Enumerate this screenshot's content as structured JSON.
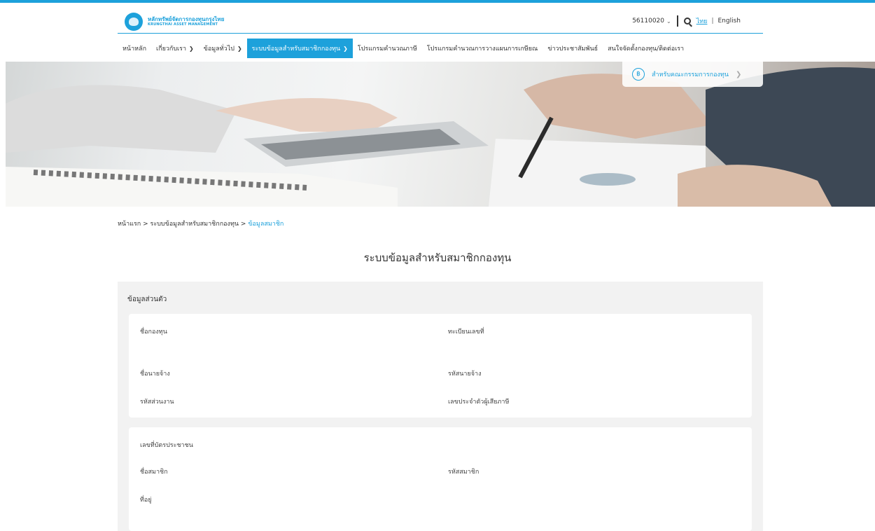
{
  "header": {
    "logo_th": "หลักทรัพย์จัดการกองทุนกรุงไทย",
    "logo_en": "KRUNGTHAI ASSET MANAGEMENT",
    "account": "56110020",
    "lang_th": "ไทย",
    "lang_sep": "|",
    "lang_en": "English"
  },
  "nav": {
    "items": [
      {
        "label": "หน้าหลัก"
      },
      {
        "label": "เกี่ยวกับเรา"
      },
      {
        "label": "ข้อมูลทั่วไป"
      },
      {
        "label": "ระบบข้อมูลสำหรับสมาชิกกองทุน"
      },
      {
        "label": "โปรแกรมคำนวณภาษี"
      },
      {
        "label": "โปรแกรมคำนวณการวางแผนการเกษียณ"
      },
      {
        "label": "ข่าวประชาสัมพันธ์"
      },
      {
        "label": "สนใจจัดตั้งกองทุน/ติดต่อเรา"
      }
    ]
  },
  "hero": {
    "committee_label": "สำหรับคณะกรรมการกองทุน"
  },
  "breadcrumb": {
    "home": "หน้าแรก",
    "sep": ">",
    "section": "ระบบข้อมูลสำหรับสมาชิกกองทุน",
    "current": "ข้อมูลสมาชิก"
  },
  "page_title": "ระบบข้อมูลสำหรับสมาชิกกองทุน",
  "panel": {
    "title": "ข้อมูลส่วนตัว",
    "card1": {
      "fund_name": "ชื่อกองทุน",
      "registration_no": "ทะเบียนเลขที่",
      "employer_name": "ชื่อนายจ้าง",
      "employer_code": "รหัสนายจ้าง",
      "department_code": "รหัสส่วนงาน",
      "tax_id": "เลขประจำตัวผู้เสียภาษี"
    },
    "card2": {
      "id_card_no": "เลขที่บัตรประชาชน",
      "member_name": "ชื่อสมาชิก",
      "member_code": "รหัสสมาชิก",
      "address": "ที่อยู่"
    }
  },
  "colors": {
    "accent": "#1da1db",
    "panel_bg": "#f2f2f2"
  }
}
